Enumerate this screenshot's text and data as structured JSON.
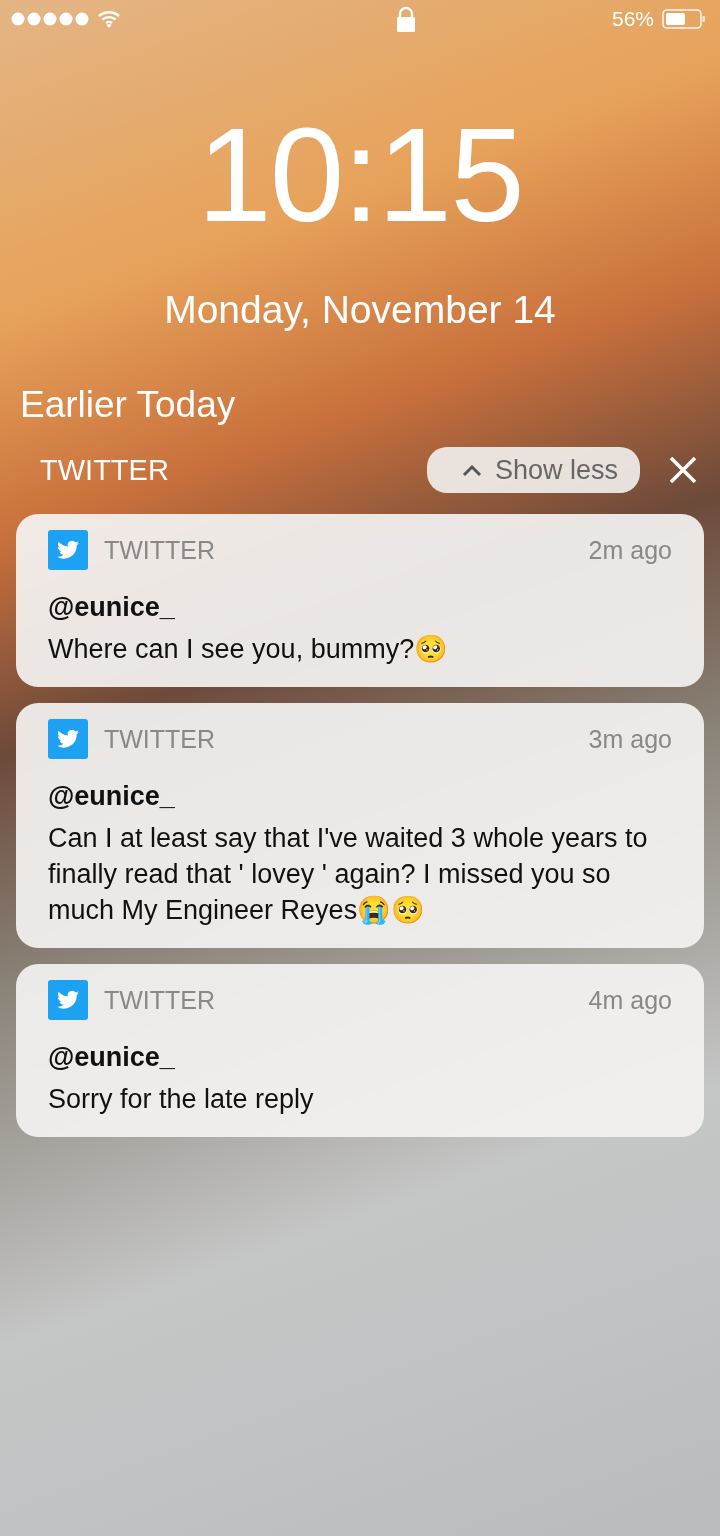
{
  "status_bar": {
    "battery": "56%"
  },
  "lock": {
    "time": "10:15",
    "date": "Monday, November 14"
  },
  "section_title": "Earlier Today",
  "group": {
    "app": "TWITTER",
    "show_less": "Show less"
  },
  "notifications": [
    {
      "app": "TWITTER",
      "time": "2m ago",
      "sender": "@eunice_",
      "message": "Where can I see you, bummy?🥺"
    },
    {
      "app": "TWITTER",
      "time": "3m ago",
      "sender": "@eunice_",
      "message": "Can I at least say that I've waited 3 whole years to finally read that ' lovey ' again? I missed you so much My Engineer Reyes😭🥺"
    },
    {
      "app": "TWITTER",
      "time": "4m ago",
      "sender": "@eunice_",
      "message": "Sorry for the late reply"
    }
  ]
}
